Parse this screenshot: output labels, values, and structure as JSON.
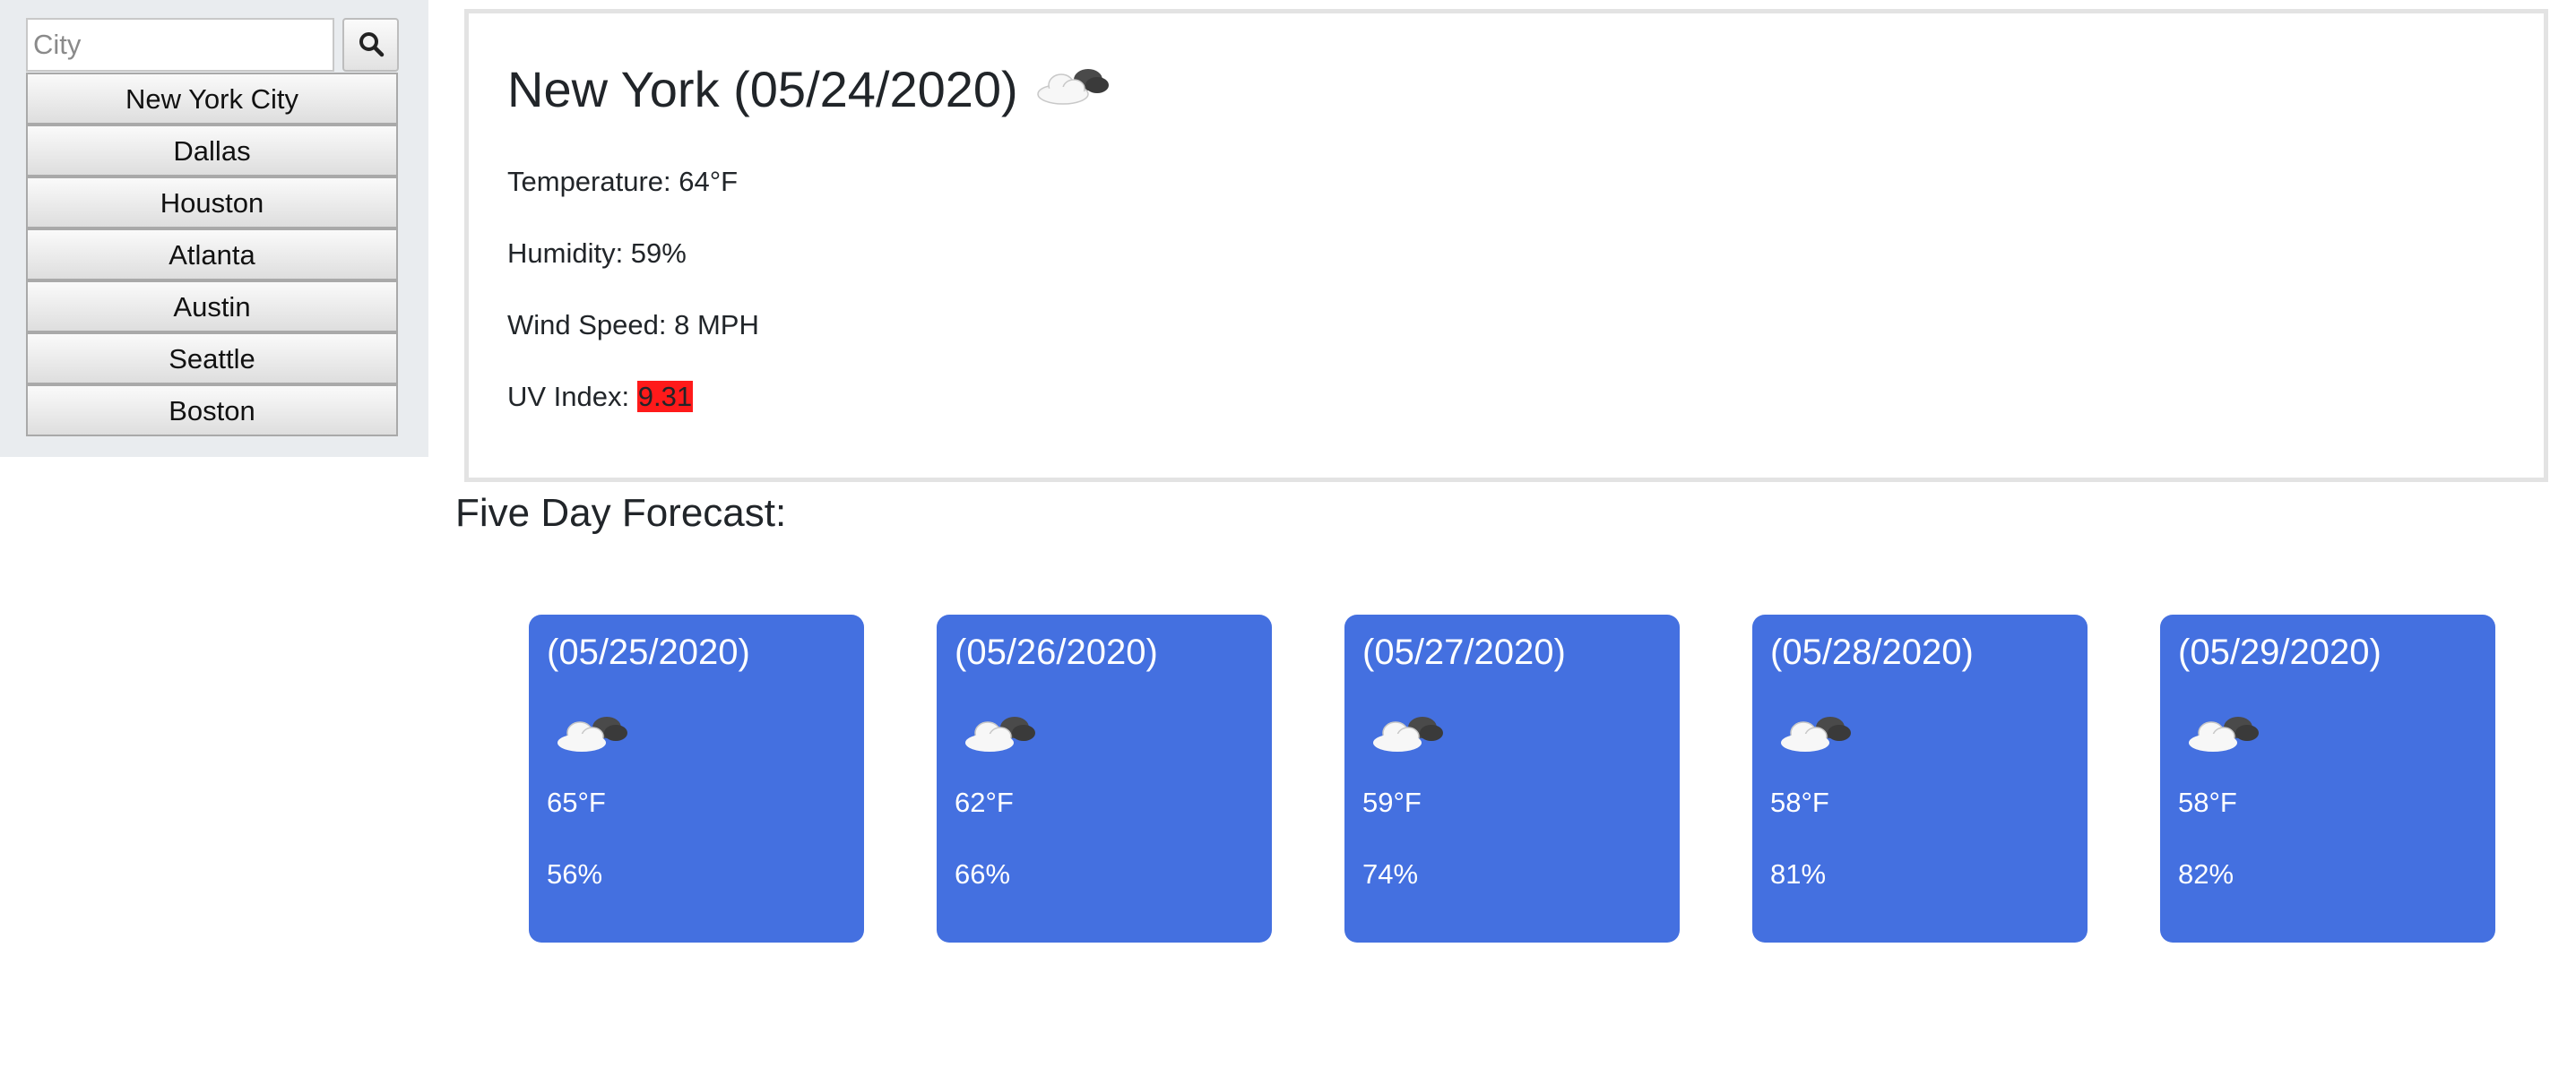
{
  "search": {
    "placeholder": "City",
    "button_icon": "search-icon"
  },
  "cities": [
    "New York City",
    "Dallas",
    "Houston",
    "Atlanta",
    "Austin",
    "Seattle",
    "Boston"
  ],
  "current": {
    "title": "New York (05/24/2020)",
    "icon": "cloud-icon",
    "temperature": "Temperature: 64°F",
    "humidity": "Humidity: 59%",
    "wind": "Wind Speed: 8 MPH",
    "uv_label": "UV Index: ",
    "uv_value": "9.31",
    "uv_color": "#ff1a1a"
  },
  "forecast": {
    "heading": "Five Day Forecast:",
    "card_color": "#4470e0",
    "days": [
      {
        "date": "(05/25/2020)",
        "icon": "cloud-icon",
        "temp": "65°F",
        "humidity": "56%"
      },
      {
        "date": "(05/26/2020)",
        "icon": "cloud-icon",
        "temp": "62°F",
        "humidity": "66%"
      },
      {
        "date": "(05/27/2020)",
        "icon": "cloud-icon",
        "temp": "59°F",
        "humidity": "74%"
      },
      {
        "date": "(05/28/2020)",
        "icon": "cloud-icon",
        "temp": "58°F",
        "humidity": "81%"
      },
      {
        "date": "(05/29/2020)",
        "icon": "cloud-icon",
        "temp": "58°F",
        "humidity": "82%"
      }
    ]
  }
}
